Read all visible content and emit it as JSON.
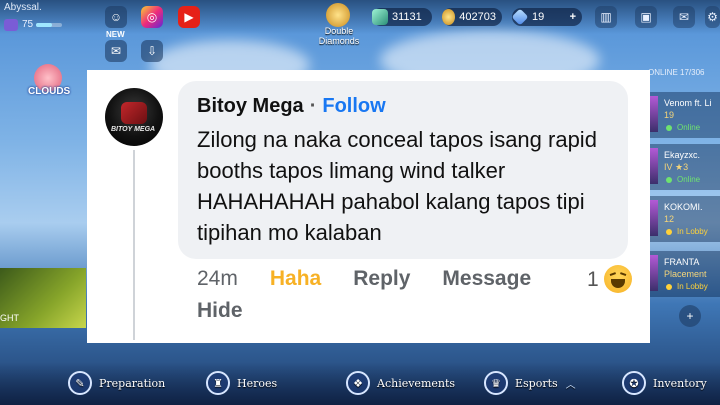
{
  "game": {
    "player_name": "Abyssal.",
    "level": "75",
    "level_progress": 0.6,
    "new_label": "NEW",
    "event_label": "Double\nDiamonds",
    "event_label_line1": "Double",
    "event_label_line2": "Diamonds",
    "currency": {
      "battle_points": "31131",
      "gold": "402703",
      "diamonds": "19",
      "plus": "+"
    },
    "clouds_label": "CLOUDS",
    "hero_panel_label": "GHT",
    "online_count": "ONLINE 17/306",
    "friends": [
      {
        "name": "Venom ft. Li",
        "rank": "19",
        "status": "Online",
        "status_color": "#6fe36f"
      },
      {
        "name": "Ekayzxc.",
        "rank": "IV ★3",
        "status": "Online",
        "status_color": "#6fe36f"
      },
      {
        "name": "KOKOMI.",
        "rank": "12",
        "status": "In Lobby",
        "status_color": "#ffd23a"
      },
      {
        "name": "FRANTA",
        "rank": "Placement",
        "status": "In Lobby",
        "status_color": "#ffd23a"
      }
    ],
    "bottom_nav": {
      "preparation": "Preparation",
      "heroes": "Heroes",
      "achievements": "Achievements",
      "esports": "Esports",
      "inventory": "Inventory"
    }
  },
  "comment": {
    "author": "Bitoy Mega",
    "separator": "·",
    "follow_label": "Follow",
    "avatar_text": "BITOY MEGA",
    "text": "Zilong na naka conceal tapos isang rapid booths tapos limang wind talker HAHAHAHAH pahabol kalang tapos tipi tipihan mo kalaban",
    "time": "24m",
    "haha_label": "Haha",
    "reply_label": "Reply",
    "message_label": "Message",
    "hide_label": "Hide",
    "reaction_count": "1",
    "reaction_icon": "haha-emoji-icon"
  }
}
